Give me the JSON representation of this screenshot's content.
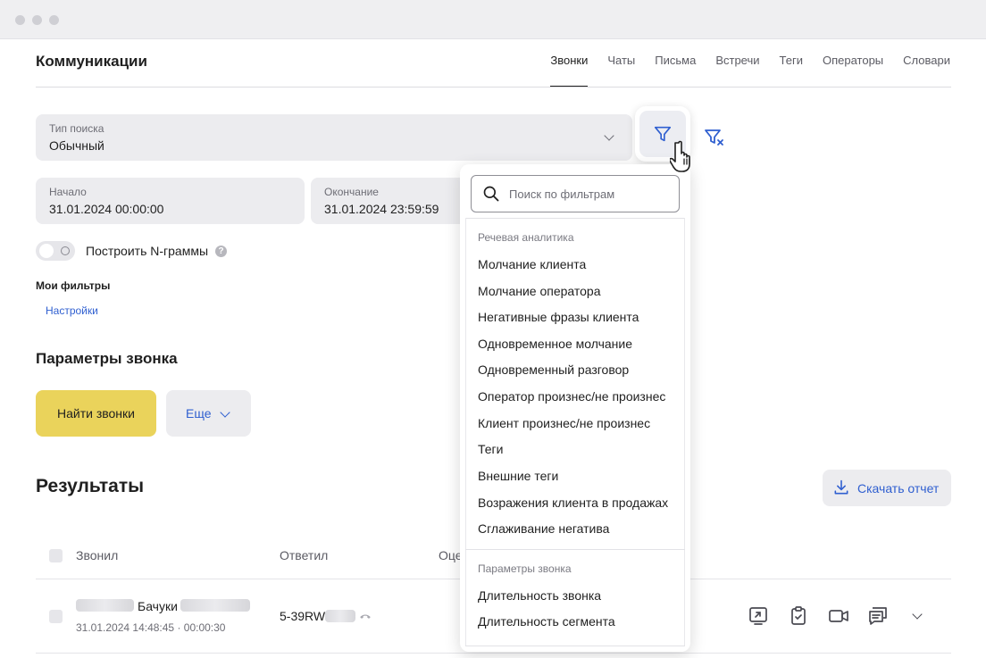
{
  "window": {
    "controls": [
      "close",
      "minimize",
      "maximize"
    ]
  },
  "header": {
    "title": "Коммуникации",
    "tabs": [
      {
        "label": "Звонки",
        "active": true
      },
      {
        "label": "Чаты"
      },
      {
        "label": "Письма"
      },
      {
        "label": "Встречи"
      },
      {
        "label": "Теги"
      },
      {
        "label": "Операторы"
      },
      {
        "label": "Словари"
      }
    ]
  },
  "search_type": {
    "label": "Тип поиска",
    "value": "Обычный"
  },
  "date_range": {
    "start_label": "Начало",
    "start_value": "31.01.2024 00:00:00",
    "end_label": "Окончание",
    "end_value": "31.01.2024 23:59:59"
  },
  "ngrams": {
    "label": "Построить N-граммы",
    "enabled": false,
    "help": "?"
  },
  "my_filters": {
    "title": "Мои фильтры",
    "settings_link": "Настройки"
  },
  "call_params": {
    "title": "Параметры звонка",
    "find_button": "Найти звонки",
    "more_button": "Еще"
  },
  "results": {
    "title": "Результаты",
    "download_button": "Скачать отчет",
    "columns": [
      "Звонил",
      "Ответил",
      "Оце"
    ],
    "rows": [
      {
        "caller_name": "Бачуки",
        "caller_meta": "31.01.2024 14:48:45 · 00:00:30",
        "answered": "5-39RW"
      }
    ]
  },
  "filter_dropdown": {
    "search_placeholder": "Поиск по фильтрам",
    "groups": [
      {
        "title": "Речевая аналитика",
        "items": [
          "Молчание клиента",
          "Молчание оператора",
          "Негативные фразы клиента",
          "Одновременное молчание",
          "Одновременный разговор",
          "Оператор произнес/не произнес",
          "Клиент произнес/не произнес",
          "Теги",
          "Внешние теги",
          "Возражения клиента в продажах",
          "Сглаживание негатива"
        ]
      },
      {
        "title": "Параметры звонка",
        "items": [
          "Длительность звонка",
          "Длительность сегмента"
        ]
      }
    ]
  },
  "colors": {
    "accent": "#2f5fd0",
    "primary_button": "#ead35b",
    "field_bg": "#ececef"
  },
  "icons": [
    "filter-icon",
    "filter-clear-icon",
    "hand-pointer-icon",
    "search-icon",
    "download-icon",
    "chevron-down-icon",
    "help-icon",
    "share-icon",
    "clipboard-check-icon",
    "video-icon",
    "chat-icon"
  ]
}
